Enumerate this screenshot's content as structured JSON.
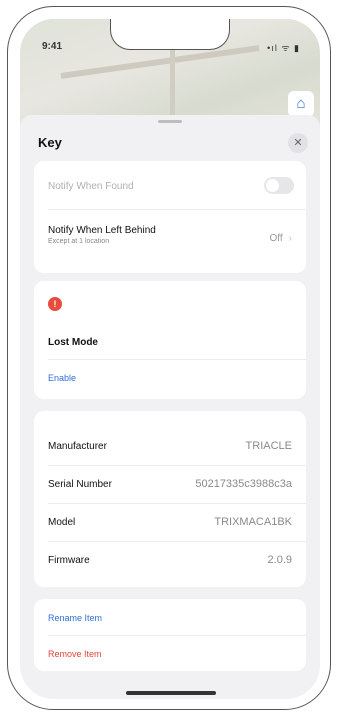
{
  "status": {
    "time": "9:41",
    "icons": "•ıl ᯤ ▮"
  },
  "map": {
    "button_icon": "binoculars-icon",
    "button_glyph": "⌂"
  },
  "sheet": {
    "title": "Key",
    "close_glyph": "✕"
  },
  "settings": {
    "disabled_label": "Notify When Found",
    "notify_label": "Notify When Left Behind",
    "notify_sub": "Except at 1 location",
    "notify_value": "Off",
    "notify_chevron": "›"
  },
  "lost_mode": {
    "icon_glyph": "!",
    "title": "Lost Mode",
    "action": "Enable"
  },
  "details": [
    {
      "label": "Manufacturer",
      "value": "TRIACLE"
    },
    {
      "label": "Serial Number",
      "value": "50217335c3988c3a"
    },
    {
      "label": "Model",
      "value": "TRIXMACA1BK"
    },
    {
      "label": "Firmware",
      "value": "2.0.9"
    }
  ],
  "actions": {
    "rename": "Rename Item",
    "remove": "Remove Item"
  },
  "colors": {
    "accent": "#2f6fd6",
    "danger": "#e0453a"
  }
}
